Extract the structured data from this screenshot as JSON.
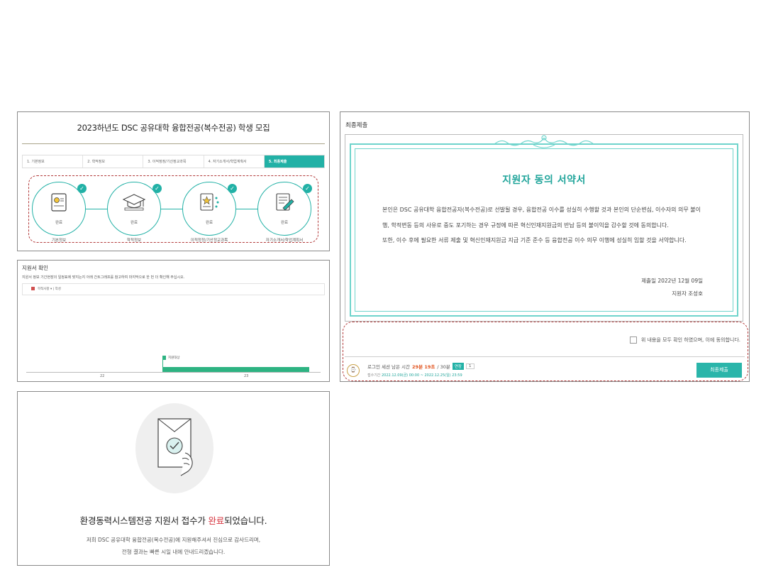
{
  "recruit": {
    "title": "2023하년도 DSC 공유대학 융합전공(복수전공) 학생 모집",
    "tabs": [
      "1. 기본정보",
      "2. 학적정보",
      "3. 이적정정/기산정교과목",
      "4. 자기소개서/학업계획서",
      "5. 최종제출"
    ],
    "active_tab": 4,
    "steps": [
      {
        "status": "완료",
        "label": "기본정보"
      },
      {
        "status": "완료",
        "label": "학적정보"
      },
      {
        "status": "완료",
        "label": "이적정정/기산정교과목"
      },
      {
        "status": "완료",
        "label": "자기소개서/학업계획서"
      }
    ]
  },
  "gantt": {
    "heading": "지원서 확인",
    "description": "지원서 정보 기간현장의 일정표에 맞지는지 아래 간트그래프를 참고하여 마지막으로 한 번 더 확인해 주십시오.",
    "filter_label": "학적사항 ▾  | 작성",
    "task_name": "지원대상",
    "tick_left": "22",
    "tick_right": "23"
  },
  "final": {
    "heading": "최종제출",
    "pledge_title": "지원자 동의 서약서",
    "paragraphs": [
      "본인은 DSC 공유대학 융합전공자(복수전공)로 선발될 경우, 융합전공 이수를 성실히 수행할 것과 본인의 단순변심, 이수자의 의무 불이행, 학적변동 등의 사유로 중도 포기하는 경우 규정에 따른 혁신인재지원금의 반납 등의 불이익을 감수할 것에 동의합니다.",
      "또한, 이수 후에 필요한 서류 제출 및 혁신인재지원금 지급 기준 준수 등 융합전공 이수 의무 이행에 성실히 임할 것을 서약합니다."
    ],
    "submit_date": "제출일  2022년 12월 09일",
    "applicant": "지원자  조성호",
    "agree_text": "위 내용을 모두 확인 하였으며, 이에 동의합니다.",
    "session_label": "로그인 세션 남은 시간",
    "session_remaining": "29분 19초",
    "session_total": "/ 30분",
    "extend_label": "연장",
    "extend_count": "1",
    "period_label": "접수기간",
    "period_value": "2022.12.09(금) 00:00 ~ 2022.12.25(일) 23:59",
    "final_button": "최종제출"
  },
  "complete": {
    "msg_prefix": "환경동력시스템전공 지원서 접수가 ",
    "msg_highlight": "완료",
    "msg_suffix": "되었습니다.",
    "sub_lines": [
      "저희 DSC 공유대학 융합전공(복수전공)에 지원해주셔서 진심으로 감사드리며,",
      "전형 결과는 빠른 시일 내에 안내드리겠습니다."
    ]
  },
  "colors": {
    "teal": "#22b1a6",
    "green": "#2db382",
    "red": "#d6313c",
    "orange": "#e1541f"
  }
}
